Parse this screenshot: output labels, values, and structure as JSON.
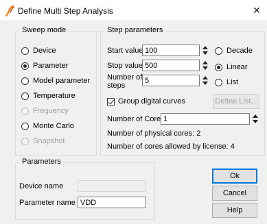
{
  "window": {
    "title": "Define Multi Step Analysis",
    "close_glyph": "✕"
  },
  "sweep_mode": {
    "title": "Sweep mode",
    "options": [
      {
        "label": "Device",
        "checked": false,
        "disabled": false
      },
      {
        "label": "Parameter",
        "checked": true,
        "disabled": false
      },
      {
        "label": "Model parameter",
        "checked": false,
        "disabled": false
      },
      {
        "label": "Temperature",
        "checked": false,
        "disabled": false
      },
      {
        "label": "Frequency",
        "checked": false,
        "disabled": true
      },
      {
        "label": "Monte Carlo",
        "checked": false,
        "disabled": false
      },
      {
        "label": "Snapshot",
        "checked": false,
        "disabled": true
      }
    ]
  },
  "step_parameters": {
    "title": "Step parameters",
    "start_label": "Start value",
    "start_value": "100",
    "stop_label": "Stop value",
    "stop_value": "500",
    "steps_label_line1": "Number of",
    "steps_label_line2": "steps",
    "steps_value": "5",
    "scale_options": [
      {
        "label": "Decade",
        "checked": false
      },
      {
        "label": "Linear",
        "checked": true
      },
      {
        "label": "List",
        "checked": false
      }
    ],
    "group_digital_label": "Group digital curves",
    "group_digital_checked": true,
    "define_list_label": "Define List...",
    "cores_label": "Number of Cores",
    "cores_value": "1",
    "physical_cores_text": "Number of physical cores: 2",
    "license_cores_text": "Number of cores allowed by license: 4"
  },
  "parameters": {
    "title": "Parameters",
    "device_name_label": "Device name",
    "device_name_value": "",
    "parameter_name_label": "Parameter name",
    "parameter_name_value": "VDD"
  },
  "buttons": {
    "ok": "Ok",
    "cancel": "Cancel",
    "help": "Help"
  },
  "colors": {
    "accent": "#0078d7",
    "icon_orange": "#f08a1c",
    "icon_red": "#d42b1e"
  }
}
